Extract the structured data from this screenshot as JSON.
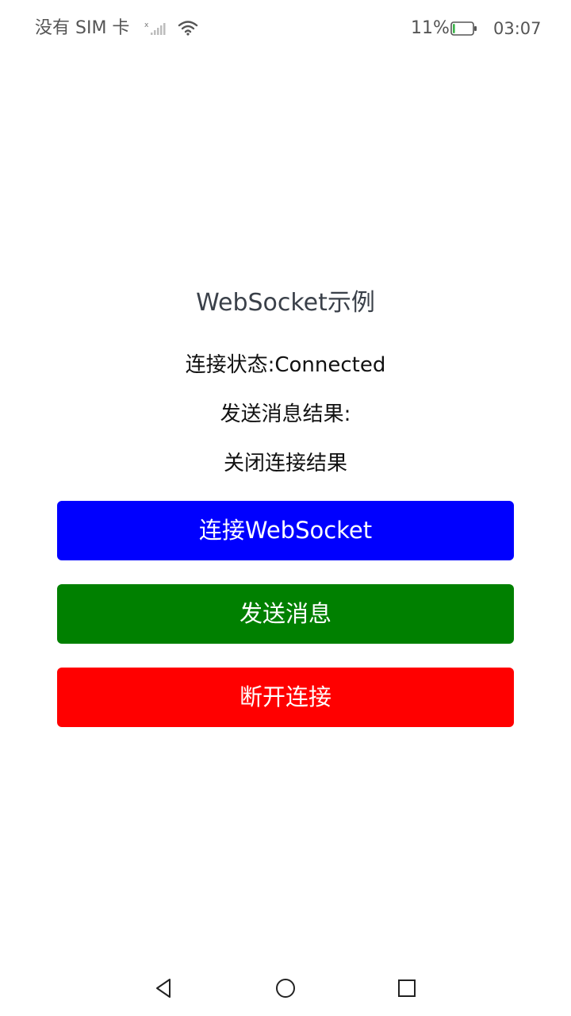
{
  "status_bar": {
    "carrier": "没有 SIM 卡",
    "battery_percent": "11%",
    "battery_level": 0.11,
    "time": "03:07",
    "icons": [
      "signal-no-sim-icon",
      "wifi-icon",
      "battery-icon"
    ]
  },
  "main": {
    "title": "WebSocket示例",
    "connection_status": "连接状态:Connected",
    "send_result": "发送消息结果:",
    "close_result": "关闭连接结果"
  },
  "buttons": {
    "connect": {
      "label": "连接WebSocket",
      "color": "#0000ff"
    },
    "send": {
      "label": "发送消息",
      "color": "#008000"
    },
    "disconnect": {
      "label": "断开连接",
      "color": "#ff0000"
    }
  },
  "nav_bar": {
    "icons": [
      "back-triangle-icon",
      "home-circle-icon",
      "recent-square-icon"
    ]
  }
}
